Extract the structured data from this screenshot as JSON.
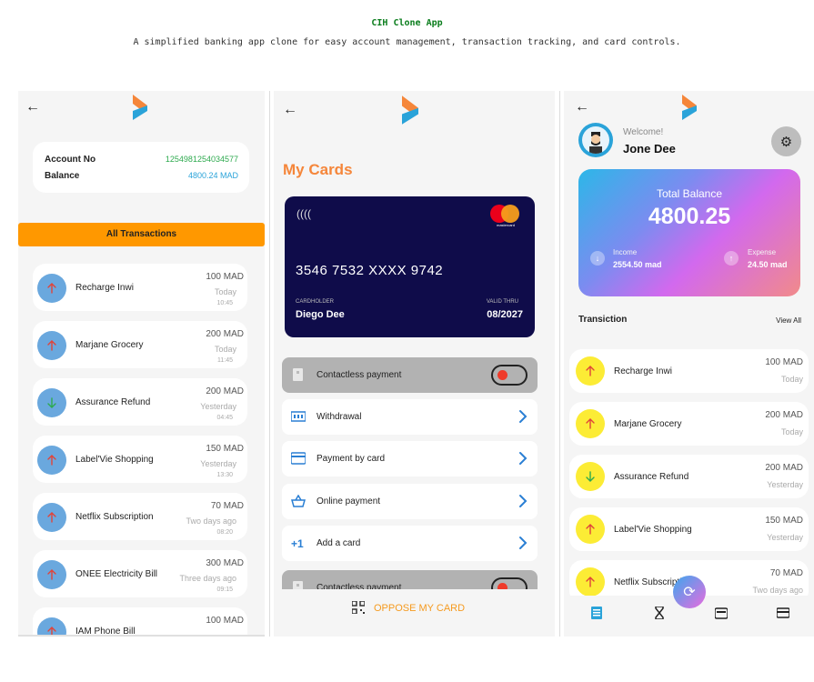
{
  "header": {
    "title": "CIH Clone App",
    "subtitle": "A simplified banking app clone for easy account management, transaction tracking, and card controls."
  },
  "colors": {
    "accent_orange": "#ff9800",
    "brand_blue": "#2aa3d9",
    "card_navy": "#0f0c4a"
  },
  "screen1": {
    "account": {
      "no_label": "Account No",
      "no_value": "1254981254034577",
      "balance_label": "Balance",
      "balance_value": "4800.24 MAD"
    },
    "all_transactions": "All Transactions",
    "transactions": [
      {
        "name": "Recharge Inwi",
        "amount": "100 MAD",
        "when": "Today",
        "time": "10:45",
        "direction": "up"
      },
      {
        "name": "Marjane Grocery",
        "amount": "200 MAD",
        "when": "Today",
        "time": "11:45",
        "direction": "up"
      },
      {
        "name": "Assurance Refund",
        "amount": "200 MAD",
        "when": "Yesterday",
        "time": "04:45",
        "direction": "down"
      },
      {
        "name": "Label'Vie Shopping",
        "amount": "150 MAD",
        "when": "Yesterday",
        "time": "13:30",
        "direction": "up"
      },
      {
        "name": "Netflix Subscription",
        "amount": "70 MAD",
        "when": "Two days ago",
        "time": "08:20",
        "direction": "up"
      },
      {
        "name": "ONEE Electricity Bill",
        "amount": "300 MAD",
        "when": "Three days ago",
        "time": "09:15",
        "direction": "up"
      },
      {
        "name": "IAM Phone Bill",
        "amount": "100 MAD",
        "when": "",
        "time": "",
        "direction": "up"
      }
    ]
  },
  "screen2": {
    "title": "My Cards",
    "card": {
      "number": "3546 7532 XXXX 9742",
      "holder_label": "CARDHOLDER",
      "holder": "Diego Dee",
      "valid_label": "VALID THRU",
      "valid": "08/2027",
      "brand": "mastercard"
    },
    "options": [
      {
        "label": "Contactless payment",
        "icon": "contactless-icon",
        "type": "toggle"
      },
      {
        "label": "Withdrawal",
        "icon": "withdrawal-icon",
        "type": "link"
      },
      {
        "label": "Payment by card",
        "icon": "card-icon",
        "type": "link"
      },
      {
        "label": "Online payment",
        "icon": "basket-icon",
        "type": "link"
      },
      {
        "label": "Add a card",
        "icon": "plus-one-icon",
        "type": "link"
      },
      {
        "label": "Contactless payment",
        "icon": "contactless-icon",
        "type": "toggle"
      }
    ],
    "oppose": "OPPOSE MY CARD"
  },
  "screen3": {
    "welcome": "Welcome!",
    "user": "Jone Dee",
    "balance_title": "Total Balance",
    "balance": "4800.25",
    "income_label": "Income",
    "income": "2554.50 mad",
    "expense_label": "Expense",
    "expense": "24.50 mad",
    "section_title": "Transiction",
    "view_all": "View All",
    "transactions": [
      {
        "name": "Recharge Inwi",
        "amount": "100 MAD",
        "when": "Today",
        "direction": "up"
      },
      {
        "name": "Marjane Grocery",
        "amount": "200 MAD",
        "when": "Today",
        "direction": "up"
      },
      {
        "name": "Assurance Refund",
        "amount": "200 MAD",
        "when": "Yesterday",
        "direction": "down"
      },
      {
        "name": "Label'Vie Shopping",
        "amount": "150 MAD",
        "when": "Yesterday",
        "direction": "up"
      },
      {
        "name": "Netflix Subscription",
        "amount": "70 MAD",
        "when": "Two days ago",
        "direction": "up"
      }
    ]
  }
}
